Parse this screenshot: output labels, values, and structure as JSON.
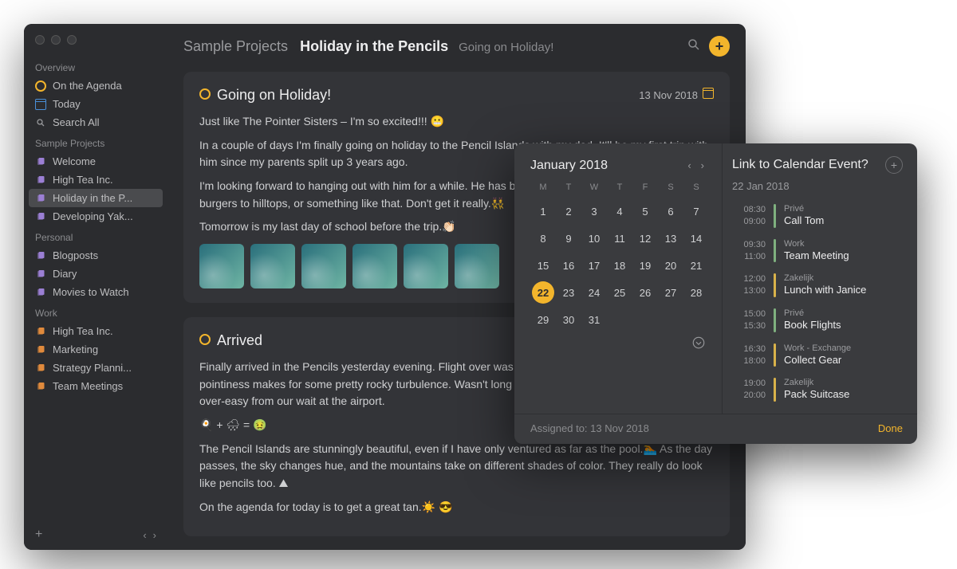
{
  "sidebar": {
    "overview_label": "Overview",
    "overview": [
      {
        "label": "On the Agenda",
        "icon": "target",
        "color": "yellow"
      },
      {
        "label": "Today",
        "icon": "today",
        "color": "blue"
      },
      {
        "label": "Search All",
        "icon": "search",
        "color": "grey"
      }
    ],
    "groups": [
      {
        "title": "Sample Projects",
        "color": "purple",
        "items": [
          {
            "label": "Welcome"
          },
          {
            "label": "High Tea Inc."
          },
          {
            "label": "Holiday in the P...",
            "active": true
          },
          {
            "label": "Developing Yak..."
          }
        ]
      },
      {
        "title": "Personal",
        "color": "purple",
        "items": [
          {
            "label": "Blogposts"
          },
          {
            "label": "Diary"
          },
          {
            "label": "Movies to Watch"
          }
        ]
      },
      {
        "title": "Work",
        "color": "orange",
        "items": [
          {
            "label": "High Tea Inc."
          },
          {
            "label": "Marketing"
          },
          {
            "label": "Strategy Planni..."
          },
          {
            "label": "Team Meetings"
          }
        ]
      }
    ]
  },
  "breadcrumb": {
    "project": "Sample Projects",
    "note": "Holiday in the Pencils",
    "sub": "Going on Holiday!"
  },
  "notes": [
    {
      "title": "Going on Holiday!",
      "date": "13 Nov 2018",
      "paragraphs": [
        "Just like The Pointer Sisters – I'm so excited!!! 😬",
        "In a couple of days I'm finally going on holiday to the Pencil Islands with my dad. It'll be my first trip with him since my parents split up 3 years ago.",
        "I'm looking forward to hanging out with him for a while. He has been reading a book about bringing burgers to hilltops, or something like that. Don't get it really.👯",
        "Tomorrow is my last day of school before the trip.👏🏻"
      ],
      "thumbs": 6
    },
    {
      "title": "Arrived",
      "date": "",
      "paragraphs": [
        "Finally arrived in the Pencils yesterday evening. Flight over was hell on the stomach — all that pointiness makes for some pretty rocky turbulence. Wasn't long before I was  neck deep in two eggs over-easy from our wait at the airport.",
        "🍳 + 🌧 = 🤢",
        "The Pencil Islands are stunningly beautiful, even if I have only ventured as far as the pool.🏊 As the day passes, the sky changes hue, and the mountains take on different shades of color. They really do look like pencils too. ⛰",
        "On the agenda for today is to get a great tan.☀️ 😎"
      ],
      "thumbs": 0
    }
  ],
  "calendar": {
    "month": "January 2018",
    "dow": [
      "M",
      "T",
      "W",
      "T",
      "F",
      "S",
      "S"
    ],
    "days": [
      [
        1,
        2,
        3,
        4,
        5,
        6,
        7
      ],
      [
        8,
        9,
        10,
        11,
        12,
        13,
        14
      ],
      [
        15,
        16,
        17,
        18,
        19,
        20,
        21
      ],
      [
        22,
        23,
        24,
        25,
        26,
        27,
        28
      ],
      [
        29,
        30,
        31
      ]
    ],
    "today": 22,
    "assigned": "Assigned to: 13 Nov 2018"
  },
  "events": {
    "title": "Link to Calendar Event?",
    "date": "22 Jan 2018",
    "list": [
      {
        "start": "08:30",
        "end": "09:00",
        "cat": "Privé",
        "name": "Call Tom",
        "color": "#7fb17f"
      },
      {
        "start": "09:30",
        "end": "11:00",
        "cat": "Work",
        "name": "Team Meeting",
        "color": "#7fb17f"
      },
      {
        "start": "12:00",
        "end": "13:00",
        "cat": "Zakelijk",
        "name": "Lunch with Janice",
        "color": "#d9b24a"
      },
      {
        "start": "15:00",
        "end": "15:30",
        "cat": "Privé",
        "name": "Book Flights",
        "color": "#7fb17f"
      },
      {
        "start": "16:30",
        "end": "18:00",
        "cat": "Work  -  Exchange",
        "name": "Collect Gear",
        "color": "#d9b24a"
      },
      {
        "start": "19:00",
        "end": "20:00",
        "cat": "Zakelijk",
        "name": "Pack Suitcase",
        "color": "#d9b24a"
      }
    ],
    "done": "Done"
  }
}
